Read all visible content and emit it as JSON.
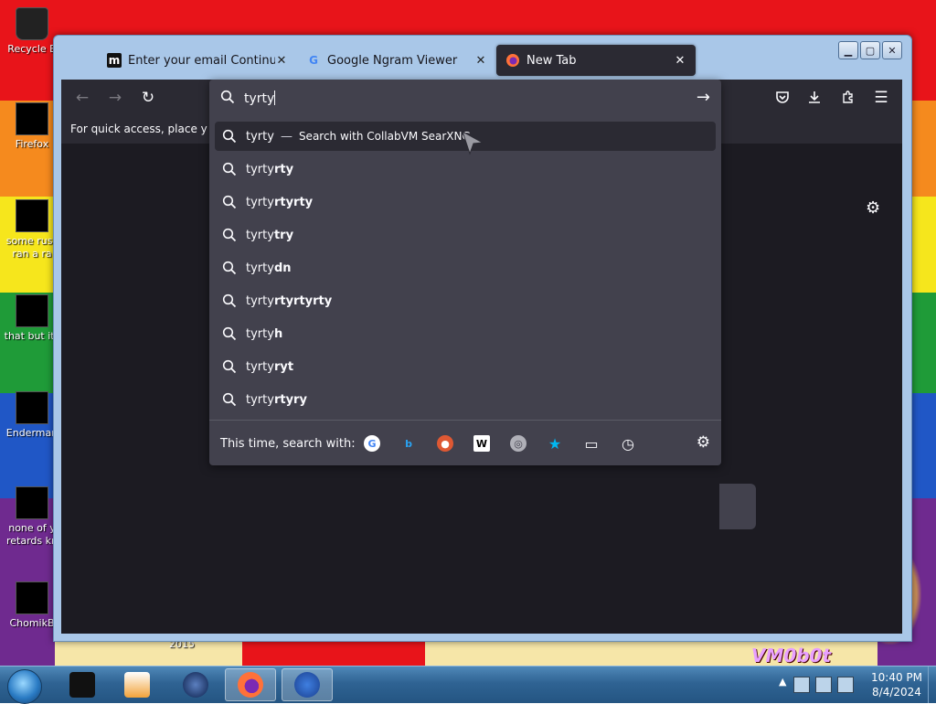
{
  "desktop": {
    "icons": [
      {
        "label": "Recycle B"
      },
      {
        "label": "Firefox"
      },
      {
        "label": "some russ\nran a ra"
      },
      {
        "label": "that but its"
      },
      {
        "label": "Enderman"
      },
      {
        "label": "none of y\nretards kn"
      },
      {
        "label": "ChomikB"
      }
    ],
    "bottom_label": "2015",
    "watermark": "VM0b0t"
  },
  "window": {
    "tabs": [
      {
        "title": "Enter your email Continue to Pe",
        "favicon": "m",
        "close": "✕"
      },
      {
        "title": "Google Ngram Viewer",
        "favicon": "G",
        "close": "✕"
      },
      {
        "title": "New Tab",
        "favicon": "firefox-icon",
        "close": "✕"
      }
    ],
    "controls": {
      "minimize": "▁",
      "maximize": "▢",
      "close": "✕"
    }
  },
  "toolbar": {
    "back": "←",
    "forward": "→",
    "reload": "↻",
    "pocket": "pocket-icon",
    "downloads": "download-icon",
    "extensions": "puzzle-icon",
    "menu": "☰"
  },
  "bookmarks_bar": {
    "text": "For quick access, place your bookmarks here"
  },
  "urlbar": {
    "query": "tyrty",
    "go": "→",
    "suggestions": [
      {
        "prefix": "tyrty",
        "suffix": "",
        "engine_text": "Search with CollabVM SearXNG",
        "separator": "—",
        "selected": true
      },
      {
        "prefix": "tyrty",
        "suffix": "rty"
      },
      {
        "prefix": "tyrty",
        "suffix": "rtyrty"
      },
      {
        "prefix": "tyrty",
        "suffix": "try"
      },
      {
        "prefix": "tyrty",
        "suffix": "dn"
      },
      {
        "prefix": "tyrty",
        "suffix": "rtyrtyrty"
      },
      {
        "prefix": "tyrty",
        "suffix": "h"
      },
      {
        "prefix": "tyrty",
        "suffix": "ryt"
      },
      {
        "prefix": "tyrty",
        "suffix": "rtyry"
      }
    ],
    "oneoff_label": "This time, search with:",
    "engines": [
      {
        "name": "google-icon",
        "glyph": "G",
        "color": "#4285f4",
        "bg": "#ffffff"
      },
      {
        "name": "bing-icon",
        "glyph": "b",
        "color": "#2aa3f2",
        "bg": "#42414d"
      },
      {
        "name": "duckduckgo-icon",
        "glyph": "●",
        "color": "#ffffff",
        "bg": "#de5833"
      },
      {
        "name": "wikipedia-icon",
        "glyph": "W",
        "color": "#000000",
        "bg": "#ffffff"
      },
      {
        "name": "searxng-icon",
        "glyph": "◎",
        "color": "#42414d",
        "bg": "#b0b0b8"
      },
      {
        "name": "bookmarks-icon",
        "glyph": "★",
        "color": "#00b7f0",
        "bg": "#42414d"
      },
      {
        "name": "tabs-icon",
        "glyph": "▭",
        "color": "#fbfbfe",
        "bg": "#42414d"
      },
      {
        "name": "history-icon",
        "glyph": "◷",
        "color": "#fbfbfe",
        "bg": "#42414d"
      }
    ],
    "settings": "⚙"
  },
  "page": {
    "settings": "⚙"
  },
  "taskbar": {
    "time": "10:40 PM",
    "date": "8/4/2024"
  },
  "colors": {
    "chrome_dark": "#2b2a33",
    "popup": "#42414d",
    "text_light": "#fbfbfe"
  }
}
